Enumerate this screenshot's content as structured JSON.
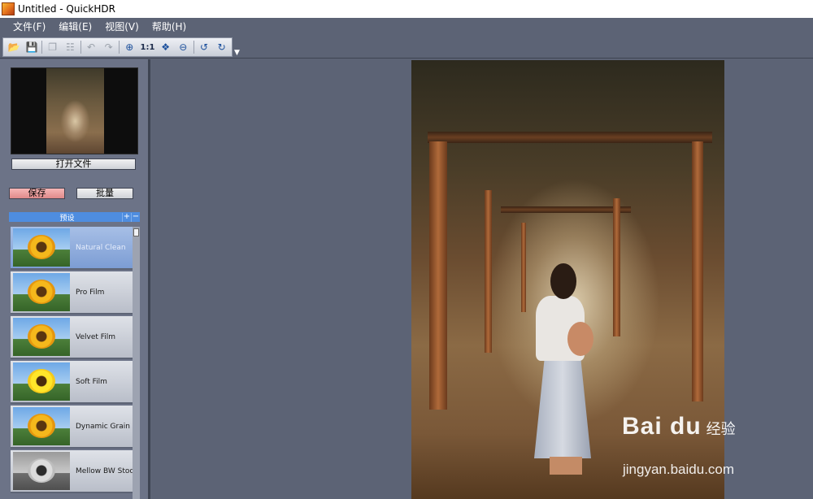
{
  "window": {
    "title": "Untitled - QuickHDR"
  },
  "menu": [
    "文件(F)",
    "编辑(E)",
    "视图(V)",
    "帮助(H)"
  ],
  "toolbar": {
    "zoom_1to1_label": "1:1",
    "icons": [
      "open-icon",
      "save-icon",
      "copy-icon",
      "paste-icon",
      "undo-icon",
      "redo-icon",
      "zoom-in-icon",
      "fit-icon",
      "zoom-out-icon",
      "rotate-left-icon",
      "rotate-right-icon"
    ]
  },
  "left_panel": {
    "open_file_label": "打开文件",
    "save_label": "保存",
    "batch_label": "批量",
    "presets_header": "预设",
    "presets_add": "+",
    "presets_remove": "−",
    "presets": [
      {
        "label": "Natural Clean",
        "selected": true
      },
      {
        "label": "Pro Film"
      },
      {
        "label": "Velvet Film"
      },
      {
        "label": "Soft Film"
      },
      {
        "label": "Dynamic Grain"
      },
      {
        "label": "Mellow BW Stock"
      }
    ]
  },
  "watermark": {
    "logo": "Bai du",
    "logo_suffix": "经验",
    "url": "jingyan.baidu.com"
  },
  "colors": {
    "background": "#5c6375",
    "preset_header": "#4e8de0",
    "save_button": "#e08a8a"
  }
}
